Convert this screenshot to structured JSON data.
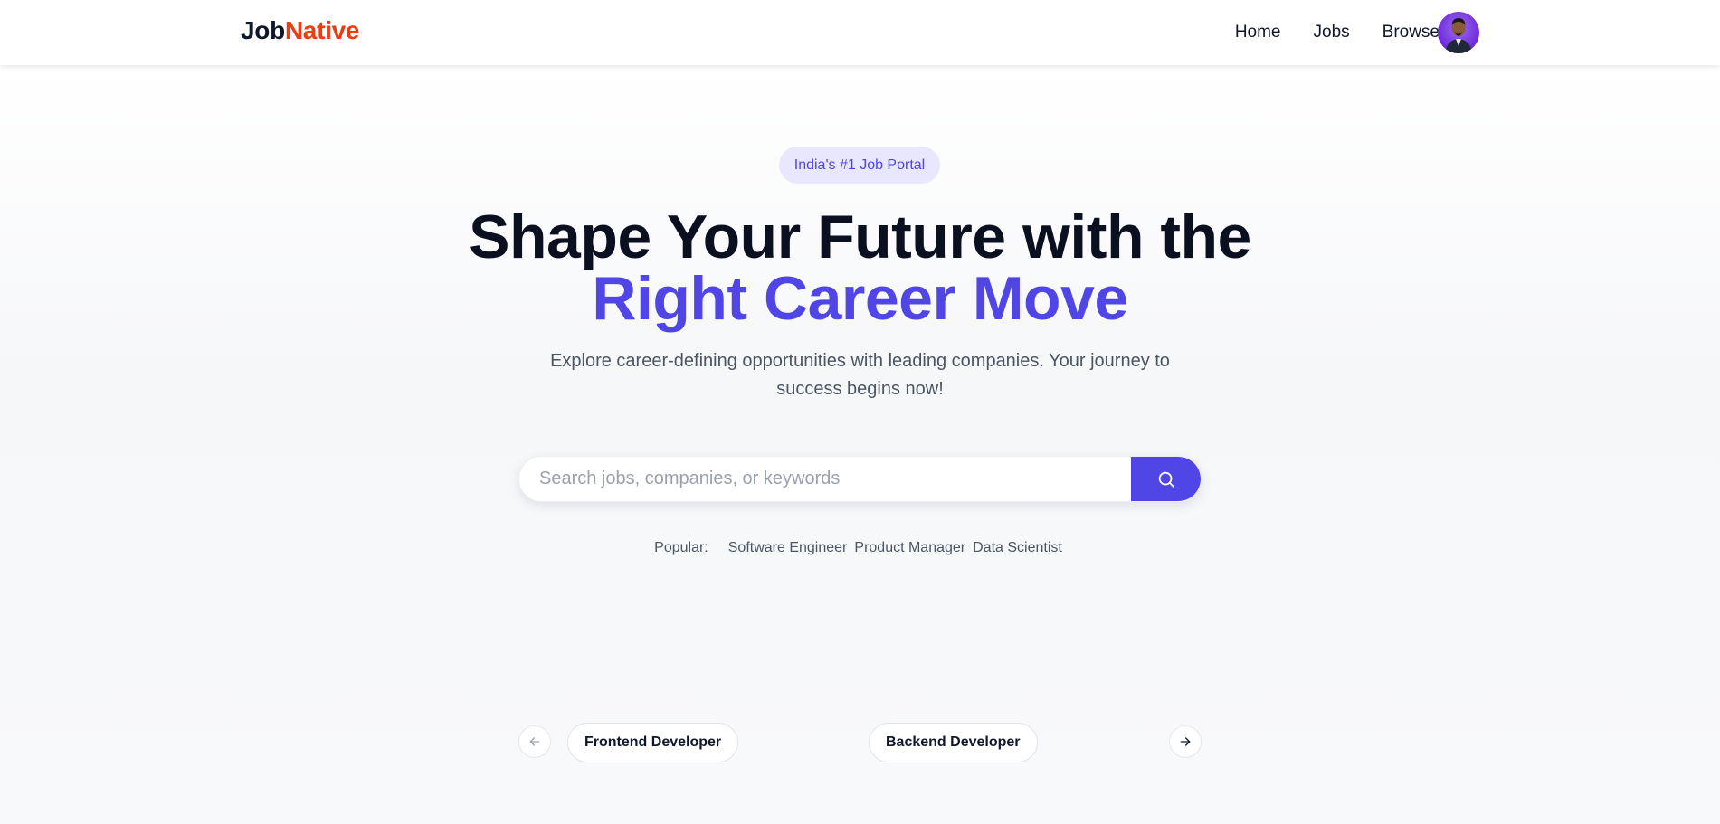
{
  "brand": {
    "name_prefix": "Job",
    "name_accent": "Native",
    "accent_color": "#ef3a12"
  },
  "nav": {
    "items": [
      {
        "label": "Home"
      },
      {
        "label": "Jobs"
      },
      {
        "label": "Browse"
      }
    ],
    "avatar_icon": "user-avatar-icon"
  },
  "hero": {
    "badge": "India's #1 Job Portal",
    "headline_line1": "Shape Your Future with the",
    "headline_line2": "Right Career Move",
    "subtitle": "Explore career-defining opportunities with leading companies. Your journey to success begins now!",
    "primary_color": "#4f46e5"
  },
  "search": {
    "placeholder": "Search jobs, companies, or keywords",
    "value": "",
    "button_icon": "search-icon"
  },
  "popular": {
    "label": "Popular:",
    "tags": [
      "Software Engineer",
      "Product Manager",
      "Data Scientist"
    ]
  },
  "carousel": {
    "prev_icon": "arrow-left-icon",
    "next_icon": "arrow-right-icon",
    "items": [
      "Frontend Developer",
      "Backend Developer"
    ]
  }
}
